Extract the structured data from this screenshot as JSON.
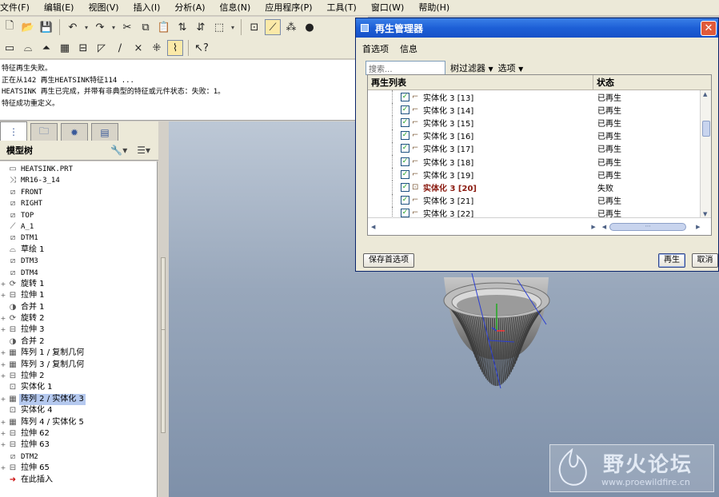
{
  "menubar": {
    "items": [
      "文件(F)",
      "编辑(E)",
      "视图(V)",
      "插入(I)",
      "分析(A)",
      "信息(N)",
      "应用程序(P)",
      "工具(T)",
      "窗口(W)",
      "帮助(H)"
    ]
  },
  "toolbar": {
    "row1_icons": [
      "new-file",
      "open-file",
      "save",
      "undo",
      "redo",
      "cut",
      "copy",
      "paste",
      "regenerate",
      "regen-manager",
      "select-box",
      "view-refit",
      "datum-planes",
      "datum-axes",
      "shading"
    ],
    "row2_icons": [
      "datum-plane",
      "sketch",
      "revolve",
      "pattern",
      "extrude",
      "blend",
      "sweep",
      "axis",
      "csys",
      "help"
    ]
  },
  "message_area": {
    "lines": [
      "特征再生失败。",
      "正在从142 再生HEATSINK特征114 ...",
      "HEATSINK 再生已完成，并带有非典型的特征或元件状态：失败：1。",
      "特征成功重定义。"
    ]
  },
  "model_tree": {
    "title": "模型树",
    "nodes": [
      {
        "label": "HEATSINK.PRT",
        "expand": ""
      },
      {
        "label": "MR16-3_14",
        "expand": ""
      },
      {
        "label": "FRONT",
        "expand": ""
      },
      {
        "label": "RIGHT",
        "expand": ""
      },
      {
        "label": "TOP",
        "expand": ""
      },
      {
        "label": "A_1",
        "expand": ""
      },
      {
        "label": "DTM1",
        "expand": ""
      },
      {
        "label": "草绘 1",
        "expand": ""
      },
      {
        "label": "DTM3",
        "expand": ""
      },
      {
        "label": "DTM4",
        "expand": ""
      },
      {
        "label": "旋转 1",
        "expand": "+"
      },
      {
        "label": "拉伸 1",
        "expand": "+"
      },
      {
        "label": "合并 1",
        "expand": ""
      },
      {
        "label": "旋转 2",
        "expand": "+"
      },
      {
        "label": "拉伸 3",
        "expand": "+"
      },
      {
        "label": "合并 2",
        "expand": ""
      },
      {
        "label": "阵列 1 / 复制几何",
        "expand": "+"
      },
      {
        "label": "阵列 3 / 复制几何",
        "expand": "+"
      },
      {
        "label": "拉伸 2",
        "expand": "+"
      },
      {
        "label": "实体化 1",
        "expand": ""
      },
      {
        "label": "阵列 2 / 实体化 3",
        "expand": "+",
        "selected": true
      },
      {
        "label": "实体化 4",
        "expand": ""
      },
      {
        "label": "阵列 4 / 实体化 5",
        "expand": "+"
      },
      {
        "label": "拉伸 62",
        "expand": "+"
      },
      {
        "label": "拉伸 63",
        "expand": "+"
      },
      {
        "label": "DTM2",
        "expand": ""
      },
      {
        "label": "拉伸 65",
        "expand": "+"
      },
      {
        "label": "在此插入",
        "expand": ""
      }
    ]
  },
  "dialog": {
    "title": "再生管理器",
    "menu": [
      "首选项",
      "信息"
    ],
    "search_value": "搜索...",
    "tree_filter": "树过滤器",
    "options": "选项",
    "col_list": "再生列表",
    "col_status": "状态",
    "rows": [
      {
        "name": "实体化 3 [13]",
        "status": "已再生"
      },
      {
        "name": "实体化 3 [14]",
        "status": "已再生"
      },
      {
        "name": "实体化 3 [15]",
        "status": "已再生"
      },
      {
        "name": "实体化 3 [16]",
        "status": "已再生"
      },
      {
        "name": "实体化 3 [17]",
        "status": "已再生"
      },
      {
        "name": "实体化 3 [18]",
        "status": "已再生"
      },
      {
        "name": "实体化 3 [19]",
        "status": "已再生"
      },
      {
        "name": "实体化 3 [20]",
        "status": "失败",
        "failed": true
      },
      {
        "name": "实体化 3 [21]",
        "status": "已再生"
      },
      {
        "name": "实体化 3 [22]",
        "status": "已再生"
      }
    ],
    "save_pref": "保存首选项",
    "regen": "再生",
    "cancel": "取消"
  },
  "watermark": {
    "title": "野火论坛",
    "url": "www.proewildfire.cn"
  }
}
